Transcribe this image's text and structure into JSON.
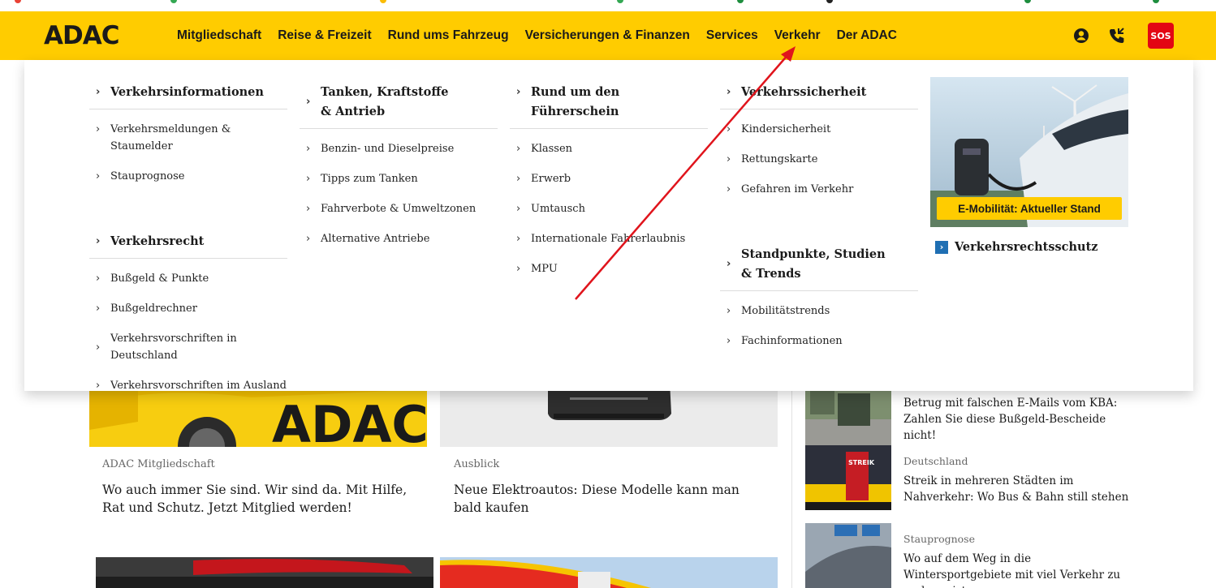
{
  "brand": {
    "logo_text": "ADAC",
    "accent": "#ffcc00",
    "sos_red": "#e30613"
  },
  "nav": {
    "items": [
      {
        "label": "Mitgliedschaft"
      },
      {
        "label": "Reise & Freizeit"
      },
      {
        "label": "Rund ums Fahrzeug"
      },
      {
        "label": "Versicherungen & Finanzen"
      },
      {
        "label": "Services"
      },
      {
        "label": "Verkehr"
      },
      {
        "label": "Der ADAC"
      }
    ],
    "icons": [
      "account-icon",
      "phone-icon",
      "sos-button"
    ],
    "sos_label": "SOS"
  },
  "mega": {
    "col1": {
      "heading1": "Verkehrsinformationen",
      "items1": [
        "Verkehrsmeldungen & Staumelder",
        "Stauprognose"
      ],
      "heading2": "Verkehrsrecht",
      "items2": [
        "Bußgeld & Punkte",
        "Bußgeldrechner",
        "Verkehrsvorschriften in Deutschland",
        "Verkehrsvorschriften im Ausland"
      ]
    },
    "col2": {
      "heading1": "Tanken, Kraftstoffe & Antrieb",
      "items1": [
        "Benzin- und Dieselpreise",
        "Tipps zum Tanken",
        "Fahrverbote & Umweltzonen",
        "Alternative Antriebe"
      ]
    },
    "col3": {
      "heading1": "Rund um den Führerschein",
      "items1": [
        "Klassen",
        "Erwerb",
        "Umtausch",
        "Internationale Fahrerlaubnis",
        "MPU"
      ]
    },
    "col4": {
      "heading1": "Verkehrssicherheit",
      "items1": [
        "Kindersicherheit",
        "Rettungskarte",
        "Gefahren im Verkehr"
      ],
      "heading2": "Standpunkte, Studien & Trends",
      "items2": [
        "Mobilitätstrends",
        "Fachinformationen"
      ]
    },
    "promo": {
      "badge": "E-Mobilität: Aktueller Stand",
      "link": "Verkehrsrechtsschutz"
    }
  },
  "cards": [
    {
      "meta": "ADAC Mitgliedschaft",
      "title": "Wo auch immer Sie sind. Wir sind da. Mit Hilfe, Rat und Schutz. Jetzt Mitglied werden!"
    },
    {
      "meta": "Ausblick",
      "title": "Neue Elektroautos: Diese Modelle kann man bald kaufen"
    }
  ],
  "sidebar": [
    {
      "category": "",
      "title": "Betrug mit falschen E-Mails vom KBA: Zahlen Sie diese Bußgeld-Bescheide nicht!"
    },
    {
      "category": "Deutschland",
      "title": "Streik in mehreren Städten im Nahverkehr: Wo Bus & Bahn still stehen"
    },
    {
      "category": "Stauprognose",
      "title": "Wo auf dem Weg in die Wintersportgebiete mit viel Verkehr zu rechnen ist"
    }
  ],
  "thumb_labels": {
    "streik": "STREIK"
  }
}
